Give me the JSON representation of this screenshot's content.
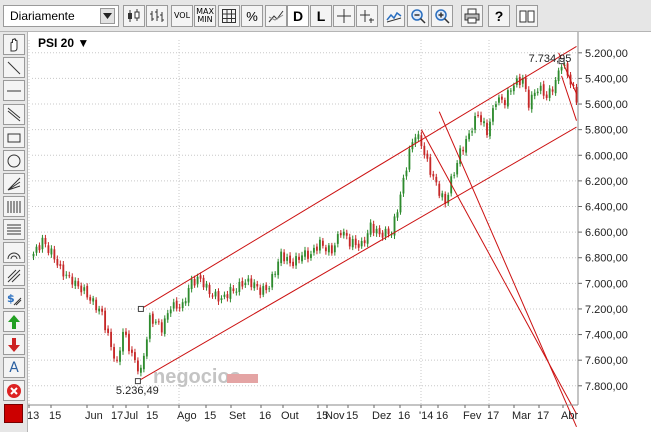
{
  "toolbar": {
    "period_label": "Diariamente",
    "vol_label": "VOL",
    "max_label": "MAX",
    "min_label": "MIN",
    "percent_label": "%",
    "d_label": "D",
    "l_label": "L",
    "help_label": "?"
  },
  "chart": {
    "title": "PSI 20 ▼",
    "watermark": "negocios",
    "low_annotation": "5.236,49",
    "high_annotation": "7.734,95",
    "y_ticks": [
      "7.800,00",
      "7.600,00",
      "7.400,00",
      "7.200,00",
      "7.000,00",
      "6.800,00",
      "6.600,00",
      "6.400,00",
      "6.200,00",
      "6.000,00",
      "5.800,00",
      "5.600,00",
      "5.400,00",
      "5.200,00"
    ],
    "x_ticks": [
      "13",
      "15",
      "Jun",
      "17",
      "Jul",
      "15",
      "Ago",
      "15",
      "Set",
      "16",
      "Out",
      "15",
      "Nov",
      "15",
      "Dez",
      "16",
      "'14",
      "16",
      "Fev",
      "17",
      "Mar",
      "17",
      "Abr"
    ],
    "colors": {
      "up": "#2e8b2e",
      "down": "#c62828",
      "trend": "#cc1111",
      "grid": "#c8c8c8"
    }
  },
  "chart_data": {
    "type": "candlestick",
    "title": "PSI 20",
    "ylim": [
      5050,
      7900
    ],
    "y_ticks": [
      5200,
      5400,
      5600,
      5800,
      6000,
      6200,
      6400,
      6600,
      6800,
      7000,
      7200,
      7400,
      7600,
      7800
    ],
    "x_tick_labels": [
      "13",
      "15",
      "Jun",
      "17",
      "Jul",
      "15",
      "Ago",
      "15",
      "Set",
      "16",
      "Out",
      "15",
      "Nov",
      "15",
      "Dez",
      "16",
      "'14",
      "16",
      "Fev",
      "17",
      "Mar",
      "17",
      "Abr"
    ],
    "segments": [
      [
        0,
        6230
      ],
      [
        3,
        6360
      ],
      [
        6,
        6230
      ],
      [
        9,
        6080
      ],
      [
        13,
        6050
      ],
      [
        16,
        5960
      ],
      [
        19,
        5850
      ],
      [
        23,
        5780
      ],
      [
        26,
        5520
      ],
      [
        28,
        5350
      ],
      [
        30,
        5600
      ],
      [
        33,
        5450
      ],
      [
        36,
        5330
      ],
      [
        39,
        5700
      ],
      [
        43,
        5650
      ],
      [
        46,
        5850
      ],
      [
        50,
        5800
      ],
      [
        53,
        6000
      ],
      [
        56,
        6060
      ],
      [
        60,
        5900
      ],
      [
        63,
        5850
      ],
      [
        66,
        5960
      ],
      [
        70,
        6000
      ],
      [
        73,
        5980
      ],
      [
        76,
        5950
      ],
      [
        79,
        6000
      ],
      [
        83,
        6200
      ],
      [
        86,
        6150
      ],
      [
        90,
        6250
      ],
      [
        93,
        6200
      ],
      [
        96,
        6300
      ],
      [
        100,
        6280
      ],
      [
        103,
        6400
      ],
      [
        106,
        6300
      ],
      [
        110,
        6320
      ],
      [
        113,
        6450
      ],
      [
        116,
        6350
      ],
      [
        120,
        6420
      ],
      [
        123,
        6700
      ],
      [
        126,
        7000
      ],
      [
        128,
        7150
      ],
      [
        130,
        7100
      ],
      [
        133,
        6900
      ],
      [
        136,
        6700
      ],
      [
        138,
        6600
      ],
      [
        140,
        6800
      ],
      [
        143,
        7050
      ],
      [
        146,
        7150
      ],
      [
        149,
        7300
      ],
      [
        152,
        7200
      ],
      [
        155,
        7450
      ],
      [
        158,
        7400
      ],
      [
        161,
        7550
      ],
      [
        164,
        7620
      ],
      [
        166,
        7420
      ],
      [
        169,
        7500
      ],
      [
        172,
        7450
      ],
      [
        175,
        7600
      ],
      [
        177,
        7735
      ],
      [
        180,
        7550
      ],
      [
        182,
        7420
      ]
    ],
    "low": {
      "value": 5236.49,
      "label": "5.236,49"
    },
    "high": {
      "value": 7734.95,
      "label": "7.734,95"
    },
    "channels": [
      {
        "name": "uptrend-upper",
        "from": [
          36,
          5800
        ],
        "to": [
          182,
          7850
        ]
      },
      {
        "name": "uptrend-lower",
        "from": [
          36,
          5250
        ],
        "to": [
          182,
          7220
        ]
      },
      {
        "name": "down-upper",
        "from": [
          136,
          7340
        ],
        "to": [
          182,
          4880
        ]
      },
      {
        "name": "down-lower",
        "from": [
          130,
          7200
        ],
        "to": [
          182,
          4980
        ]
      },
      {
        "name": "short-channel-a",
        "from": [
          176,
          7800
        ],
        "to": [
          182,
          7480
        ]
      },
      {
        "name": "short-channel-b",
        "from": [
          177,
          7620
        ],
        "to": [
          182,
          7270
        ]
      }
    ]
  }
}
